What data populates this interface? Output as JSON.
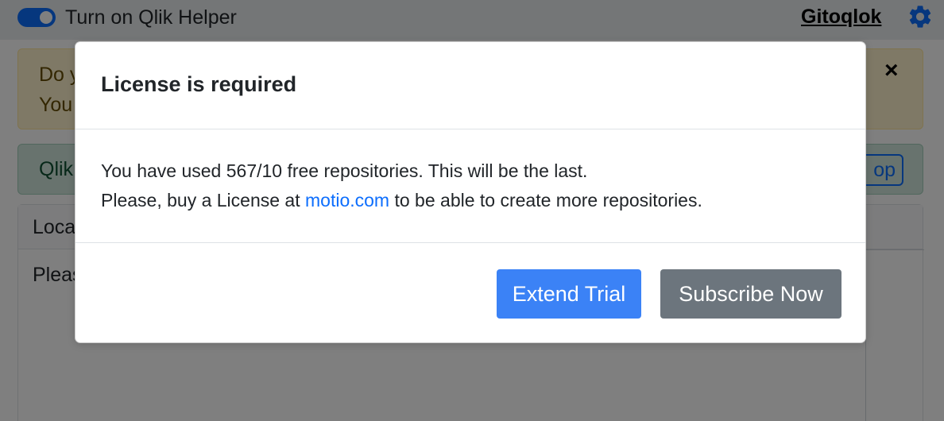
{
  "topbar": {
    "toggle_label": "Turn on Qlik Helper",
    "brand_link": "Gitoqlok",
    "settings_icon": "gear-icon"
  },
  "warning_alert": {
    "line1": "Do y",
    "line2": "You",
    "close_label": "×"
  },
  "success_alert": {
    "text": "Qlik",
    "button_label": "op"
  },
  "card": {
    "header": "Loca",
    "body": "Pleas"
  },
  "modal": {
    "title": "License is required",
    "body_line1": "You have used 567/10 free repositories. This will be the last.",
    "body_line2_prefix": "Please, buy a License at ",
    "body_link": "motio.com",
    "body_line2_suffix": " to be able to create more repositories.",
    "extend_trial_label": "Extend Trial",
    "subscribe_now_label": "Subscribe Now"
  },
  "colors": {
    "primary": "#3b82f6",
    "secondary": "#6c757d",
    "link": "#0d6efd"
  }
}
